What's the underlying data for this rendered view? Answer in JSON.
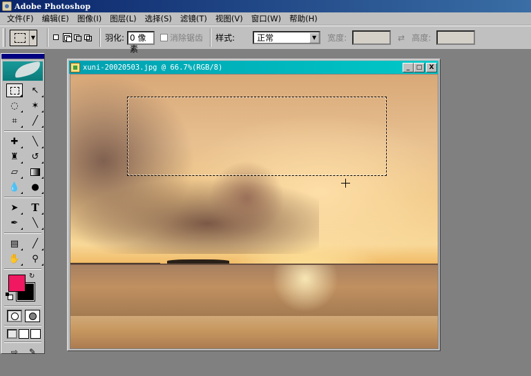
{
  "window": {
    "title": "Adobe Photoshop"
  },
  "menu": [
    {
      "label": "文件(F)"
    },
    {
      "label": "编辑(E)"
    },
    {
      "label": "图像(I)"
    },
    {
      "label": "图层(L)"
    },
    {
      "label": "选择(S)"
    },
    {
      "label": "滤镜(T)"
    },
    {
      "label": "视图(V)"
    },
    {
      "label": "窗口(W)"
    },
    {
      "label": "帮助(H)"
    }
  ],
  "options": {
    "feather_label": "羽化:",
    "feather_value": "0 像素",
    "antialias_label": "消除锯齿",
    "style_label": "样式:",
    "style_value": "正常",
    "width_label": "宽度:",
    "height_label": "高度:"
  },
  "document": {
    "title": "xuni-20020503.jpg @ 66.7%(RGB/8)",
    "minimize": "_",
    "maximize": "□",
    "close": "X"
  },
  "toolbox": {
    "type_tool": "T",
    "foreground_color": "#f01860",
    "background_color": "#000000"
  },
  "colors": {
    "titlebar": "#0a246a",
    "doc_titlebar": "#00b8c0",
    "chrome": "#c0c0c0",
    "workspace": "#808080"
  }
}
